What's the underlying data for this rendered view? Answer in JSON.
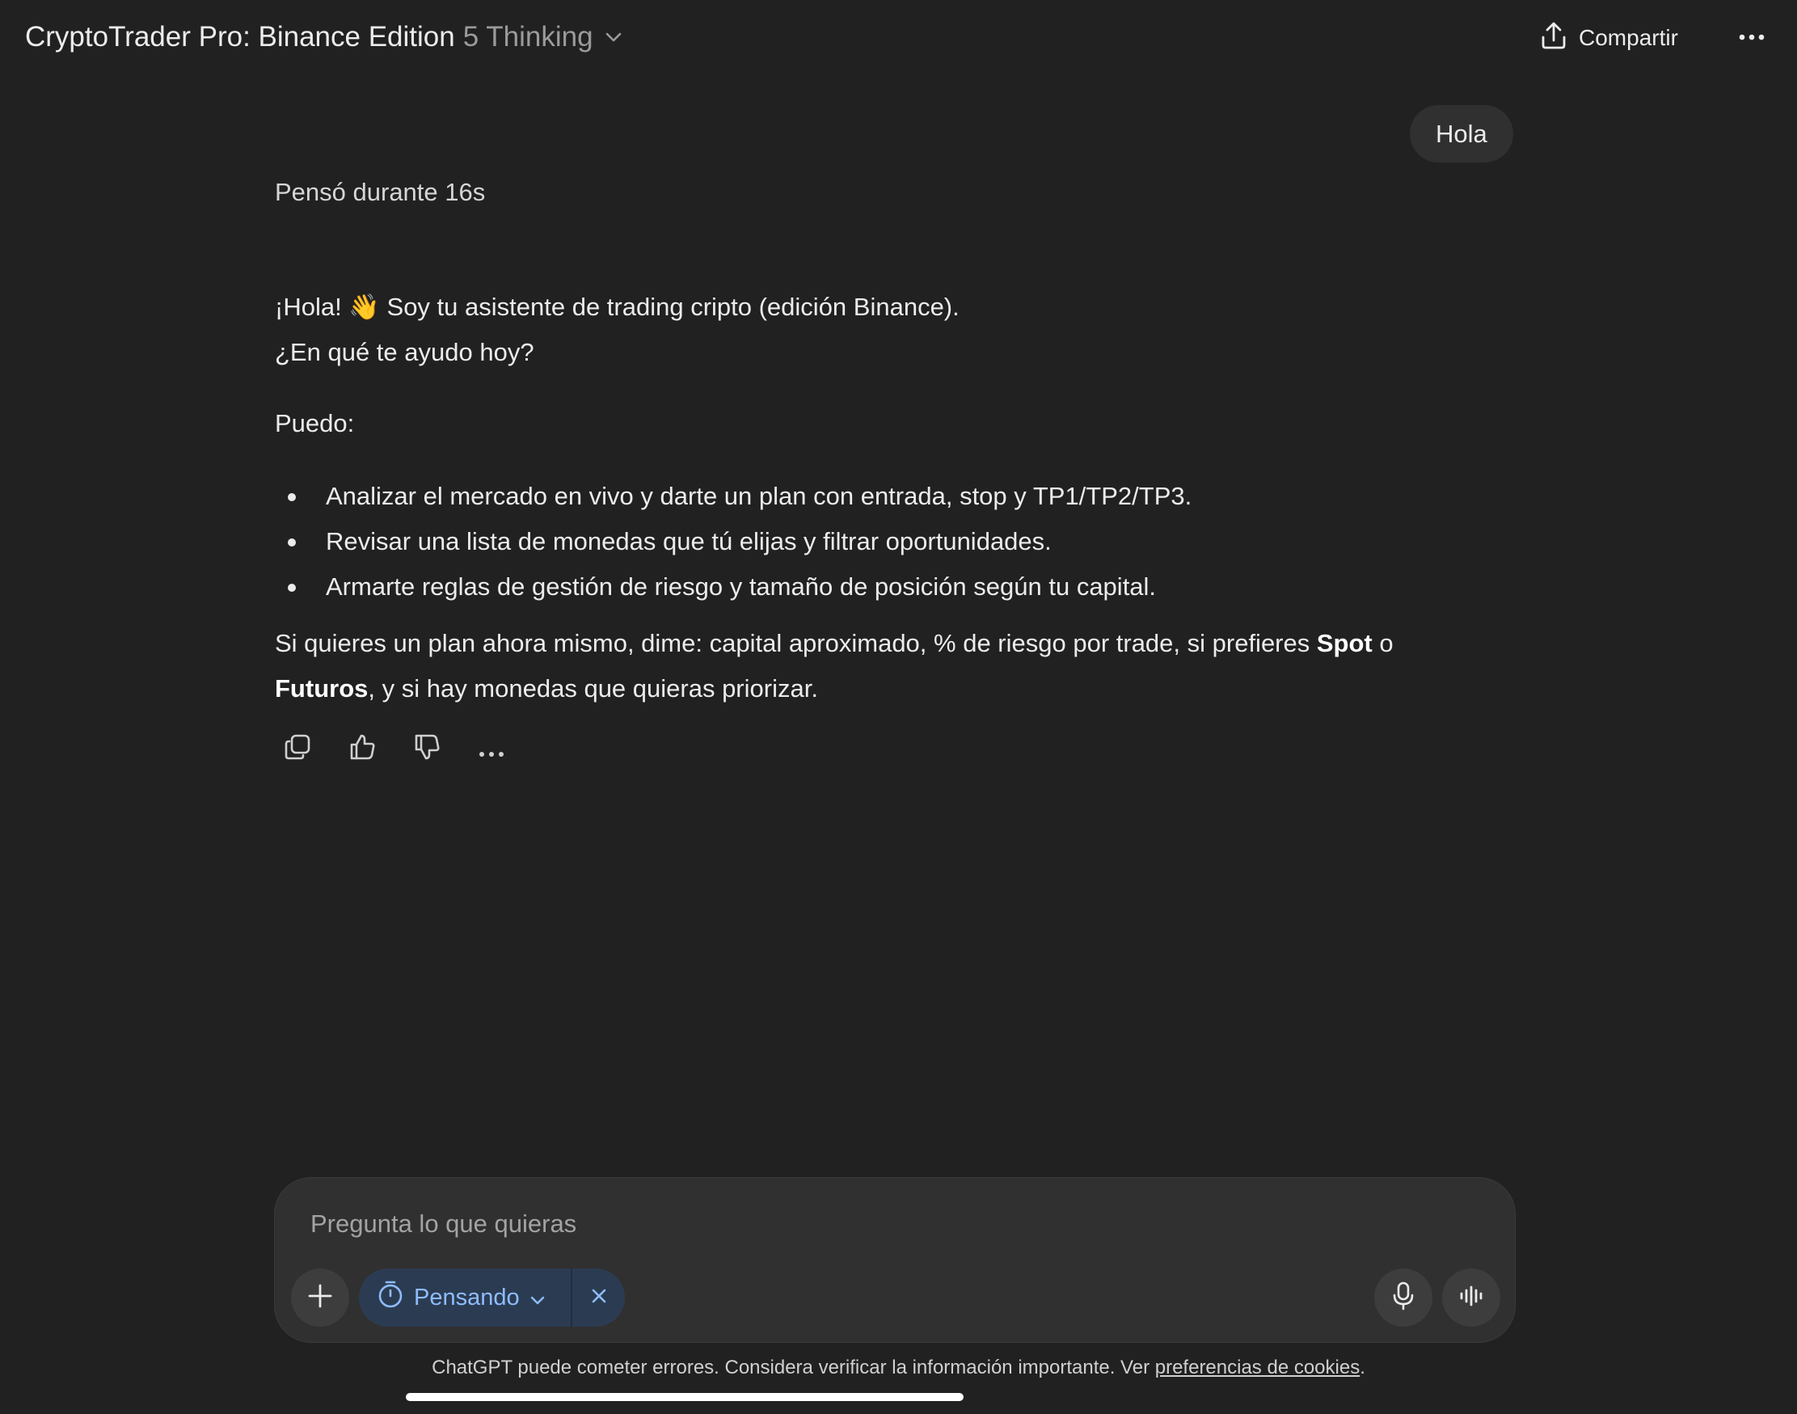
{
  "header": {
    "title": "CryptoTrader Pro: Binance Edition",
    "model": "5 Thinking",
    "share_label": "Compartir",
    "icons": {
      "chevron": "chevron-down-icon",
      "share": "upload-icon",
      "more": "ellipsis-icon"
    }
  },
  "conversation": {
    "user_message": "Hola",
    "assistant": {
      "thought_label": "Pensó durante 16s",
      "greeting": "¡Hola! 👋 Soy tu asistente de trading cripto (edición Binance).",
      "question": "¿En qué te ayudo hoy?",
      "intro": "Puedo:",
      "bullets": [
        "Analizar el mercado en vivo y darte un plan con entrada, stop y TP1/TP2/TP3.",
        "Revisar una lista de monedas que tú elijas y filtrar oportunidades.",
        "Armarte reglas de gestión de riesgo y tamaño de posición según tu capital."
      ],
      "closing": {
        "part1": "Si quieres un plan ahora mismo, dime: capital aproximado, % de riesgo por trade, si prefieres ",
        "bold1": "Spot",
        "part2": " o ",
        "bold2": "Futuros",
        "part3": ", y si hay monedas que quieras priorizar."
      },
      "actions": [
        "copy-icon",
        "thumbs-up-icon",
        "thumbs-down-icon",
        "ellipsis-icon"
      ]
    }
  },
  "composer": {
    "placeholder": "Pregunta lo que quieras",
    "value": "",
    "mode_label": "Pensando",
    "icons": {
      "plus": "plus-icon",
      "mode": "timer-icon",
      "close": "close-icon",
      "mic": "microphone-icon",
      "voice": "voice-wave-icon"
    }
  },
  "footer": {
    "disclaimer": "ChatGPT puede cometer errores. Considera verificar la información importante. Ver ",
    "link": "preferencias de cookies",
    "end": "."
  },
  "colors": {
    "background": "#212121",
    "bubble": "#303030",
    "accent_pill": "#2b3c52",
    "accent_text": "#8fbcff",
    "text": "#ececec",
    "muted": "#9b9b9b"
  }
}
